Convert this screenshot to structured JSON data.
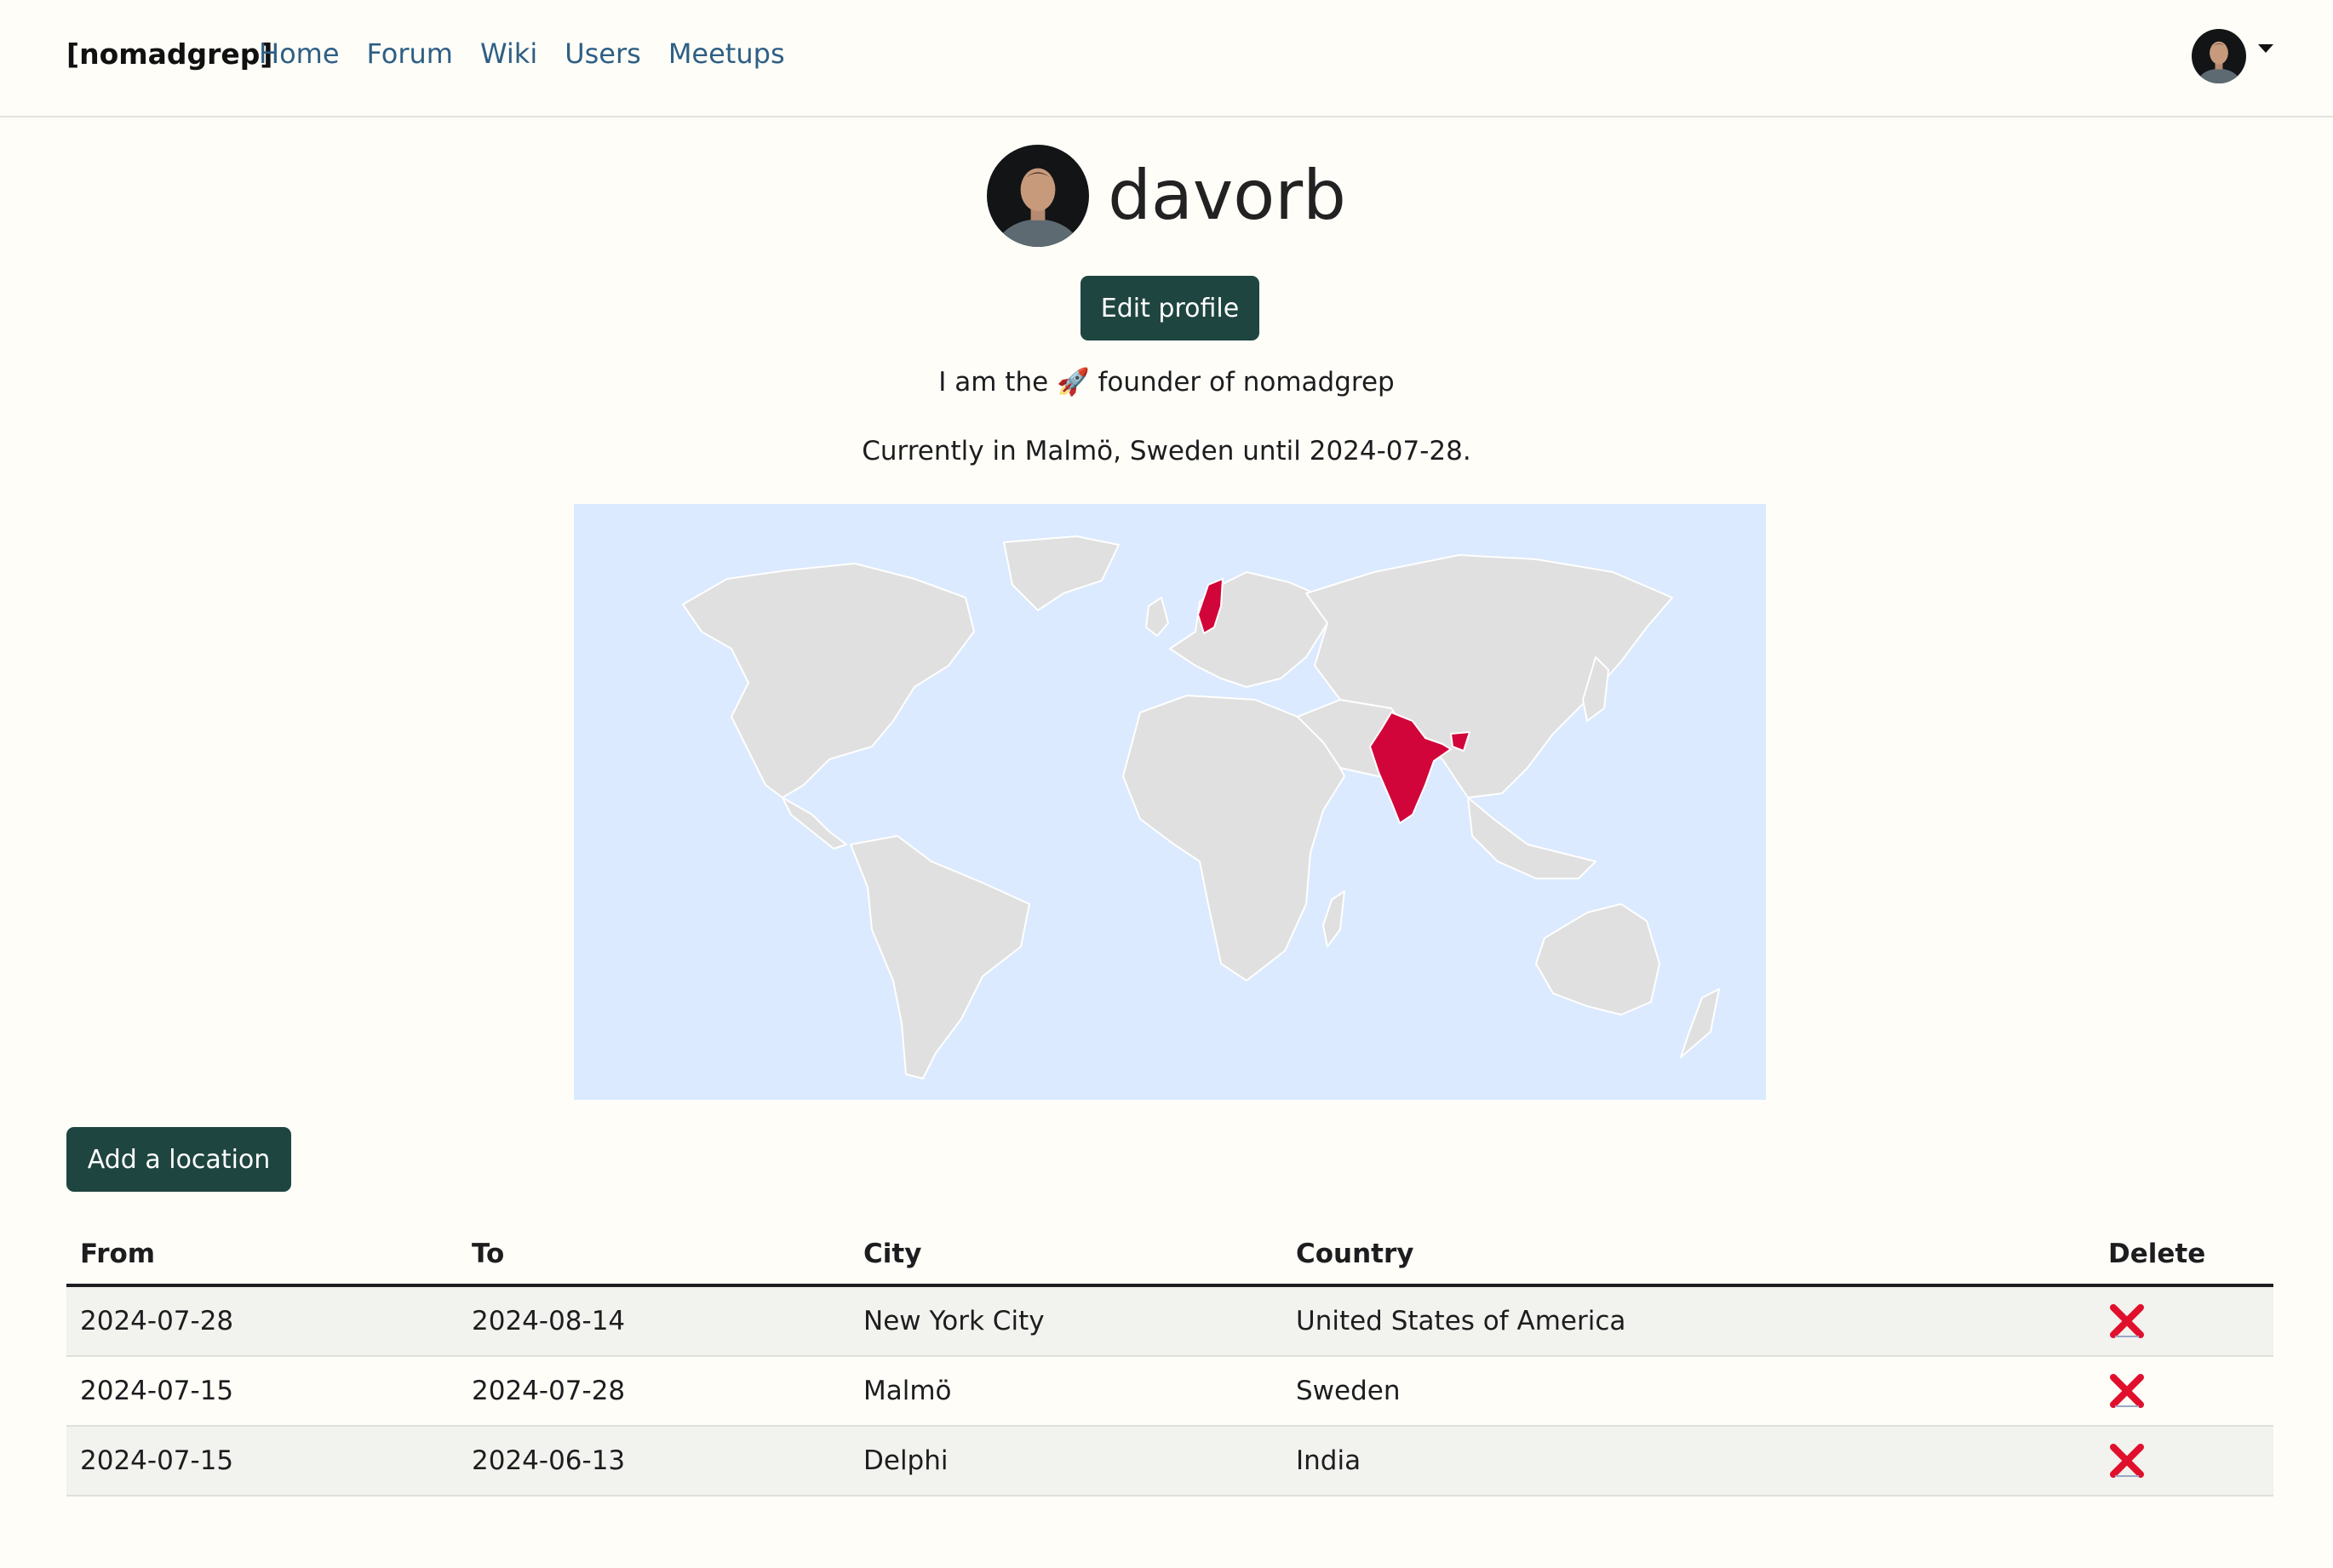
{
  "nav": {
    "brand": "[nomadgrep]",
    "links": [
      "Home",
      "Forum",
      "Wiki",
      "Users",
      "Meetups"
    ]
  },
  "profile": {
    "username": "davorb",
    "edit_label": "Edit profile",
    "bio": "I am the 🚀 founder of nomadgrep",
    "current": "Currently in Malmö, Sweden until 2024-07-28."
  },
  "map": {
    "ocean_color": "#dbeafe",
    "land_color": "#e0e0e0",
    "visited_color": "#d2053a",
    "visited_countries": [
      "Sweden",
      "India"
    ]
  },
  "locations": {
    "add_label": "Add a location",
    "headers": [
      "From",
      "To",
      "City",
      "Country",
      "Delete"
    ],
    "rows": [
      {
        "from": "2024-07-28",
        "to": "2024-08-14",
        "city": "New York City",
        "country": "United States of America"
      },
      {
        "from": "2024-07-15",
        "to": "2024-07-28",
        "city": "Malmö",
        "country": "Sweden"
      },
      {
        "from": "2024-07-15",
        "to": "2024-06-13",
        "city": "Delphi",
        "country": "India"
      }
    ],
    "delete_icon": "red-x-icon"
  },
  "colors": {
    "accent": "#1f4540",
    "link": "#2f5f84",
    "background": "#fefdf8"
  }
}
